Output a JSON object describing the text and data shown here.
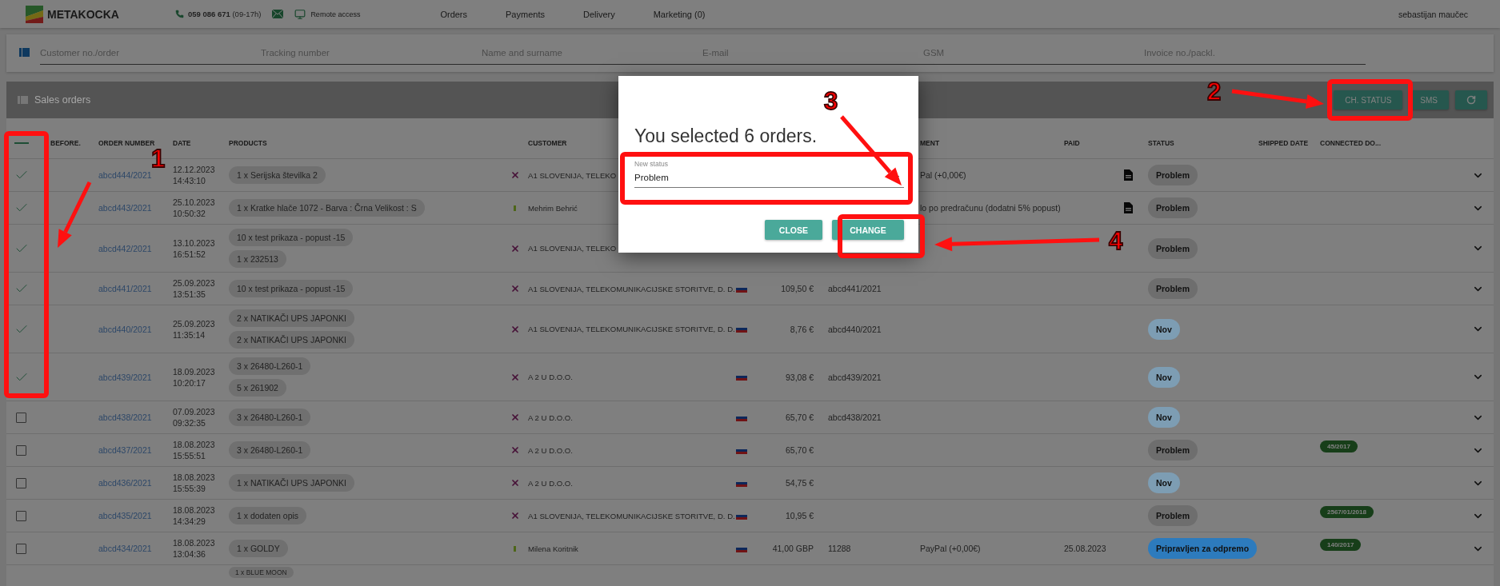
{
  "nav": {
    "brand": "METAKOCKA",
    "phone": "**059 086 671** (09-17h)",
    "remote": "Remote access",
    "menu": [
      {
        "label": "Orders"
      },
      {
        "label": "Payments"
      },
      {
        "label": "Delivery"
      },
      {
        "label": "Marketing (0)"
      }
    ],
    "user": "sebastijan maučec"
  },
  "search": {
    "fields": [
      {
        "placeholder": "Customer no./order"
      },
      {
        "placeholder": "Tracking number"
      },
      {
        "placeholder": "Name and surname"
      },
      {
        "placeholder": "E-mail"
      },
      {
        "placeholder": "GSM"
      },
      {
        "placeholder": "Invoice no./packl."
      }
    ]
  },
  "panel": {
    "title": "Sales orders",
    "buttons": [
      {
        "kind": "text",
        "label": "CH. STATUS"
      },
      {
        "kind": "text",
        "label": "SMS"
      },
      {
        "kind": "refresh"
      }
    ]
  },
  "table": {
    "header": {
      "before": "BEFORE.",
      "order": "ORDER NUMBER",
      "date": "DATE",
      "products": "PRODUCTS",
      "customer": "CUSTOMER",
      "payment": "MENT",
      "paid": "PAID",
      "status": "STATUS",
      "shipped": "SHIPPED DATE",
      "connected": "CONNECTED DO..."
    },
    "rows": [
      {
        "selected": true,
        "order": "abcd444/2021",
        "date": "12.12.2023",
        "time": "14:43:10",
        "products": [
          "1 x Serijska številka 2"
        ],
        "mark": {
          "kind": "cross"
        },
        "customer": "A1 SLOVENIJA, TELEKO",
        "flag": false,
        "payment": "Pal (+0,00€)",
        "invoice": true,
        "status": {
          "label": "Problem",
          "color": "#6e6e6e"
        }
      },
      {
        "selected": true,
        "order": "abcd443/2021",
        "date": "25.10.2023",
        "time": "10:50:32",
        "products": [
          "1 x Kratke hlače 1072 - Barva : Črna Velikost : S"
        ],
        "mark": {
          "kind": "dot"
        },
        "customer": "Mehrim Behrić",
        "flag": false,
        "payment": "lo po predračunu (dodatni 5% popust)",
        "invoice": true,
        "status": {
          "label": "Problem",
          "color": "#6e6e6e"
        }
      },
      {
        "selected": true,
        "order": "abcd442/2021",
        "date": "13.10.2023",
        "time": "16:51:52",
        "products": [
          "10 x test prikaza - popust -15",
          "1 x 232513"
        ],
        "mark": {
          "kind": "cross"
        },
        "customer": "A1 SLOVENIJA, TELEKO",
        "flag": false,
        "invoice": false,
        "status": {
          "label": "Problem",
          "color": "#6e6e6e"
        }
      },
      {
        "selected": true,
        "order": "abcd441/2021",
        "date": "25.09.2023",
        "time": "13:51:35",
        "products": [
          "10 x test prikaza - popust -15"
        ],
        "mark": {
          "kind": "cross"
        },
        "customer": "A1 SLOVENIJA, TELEKOMUNIKACIJSKE STORITVE, D. D.",
        "flag": true,
        "amount": "109,50 €",
        "number": "abcd441/2021",
        "invoice": false,
        "status": {
          "label": "Problem",
          "color": "#6e6e6e"
        }
      },
      {
        "selected": true,
        "order": "abcd440/2021",
        "date": "25.09.2023",
        "time": "11:35:14",
        "products": [
          "2 x NATIKAČI UPS JAPONKI",
          "2 x NATIKAČI UPS JAPONKI"
        ],
        "mark": {
          "kind": "cross"
        },
        "customer": "A1 SLOVENIJA, TELEKOMUNIKACIJSKE STORITVE, D. D.",
        "flag": true,
        "amount": "8,76 €",
        "number": "abcd440/2021",
        "invoice": false,
        "status": {
          "label": "Nov",
          "color": "#7d9db3"
        }
      },
      {
        "selected": true,
        "order": "abcd439/2021",
        "date": "18.09.2023",
        "time": "10:20:17",
        "products": [
          "3 x 26480-L260-1",
          "5 x 261902"
        ],
        "mark": {
          "kind": "cross"
        },
        "customer": "A 2 U D.O.O.",
        "flag": true,
        "amount": "93,08 €",
        "number": "abcd439/2021",
        "invoice": false,
        "status": {
          "label": "Nov",
          "color": "#7d9db3"
        }
      },
      {
        "selected": false,
        "order": "abcd438/2021",
        "date": "07.09.2023",
        "time": "09:32:35",
        "products": [
          "3 x 26480-L260-1"
        ],
        "mark": {
          "kind": "cross"
        },
        "customer": "A 2 U D.O.O.",
        "flag": true,
        "amount": "65,70 €",
        "number": "abcd438/2021",
        "invoice": false,
        "status": {
          "label": "Nov",
          "color": "#7d9db3"
        }
      },
      {
        "selected": false,
        "order": "abcd437/2021",
        "date": "18.08.2023",
        "time": "15:55:51",
        "products": [
          "3 x 26480-L260-1"
        ],
        "mark": {
          "kind": "cross"
        },
        "customer": "A 2 U D.O.O.",
        "flag": true,
        "amount": "65,70 €",
        "invoice": false,
        "status": {
          "label": "Problem",
          "color": "#6e6e6e"
        },
        "connected": "45/2017"
      },
      {
        "selected": false,
        "order": "abcd436/2021",
        "date": "18.08.2023",
        "time": "15:55:39",
        "products": [
          "1 x NATIKAČI UPS JAPONKI"
        ],
        "mark": {
          "kind": "cross"
        },
        "customer": "A 2 U D.O.O.",
        "flag": true,
        "amount": "54,75 €",
        "invoice": false,
        "status": {
          "label": "Nov",
          "color": "#7d9db3"
        }
      },
      {
        "selected": false,
        "order": "abcd435/2021",
        "date": "18.08.2023",
        "time": "14:34:29",
        "products": [
          "1 x dodaten opis"
        ],
        "mark": {
          "kind": "cross"
        },
        "customer": "A1 SLOVENIJA, TELEKOMUNIKACIJSKE STORITVE, D. D.",
        "flag": true,
        "amount": "10,95 €",
        "invoice": false,
        "status": {
          "label": "Problem",
          "color": "#6e6e6e"
        },
        "connected": "2567/01/2018"
      },
      {
        "selected": false,
        "order": "abcd434/2021",
        "date": "18.08.2023",
        "time": "13:04:36",
        "products": [
          "1 x GOLDY"
        ],
        "mark": {
          "kind": "dot"
        },
        "customer": "Milena Koritnik",
        "flag": true,
        "amount": "41,00 GBP",
        "number": "11288",
        "payment": "PayPal (+0,00€)",
        "invoice": false,
        "paid": "25.08.2023",
        "status": {
          "label": "Pripravljen za odpremo",
          "color": "#2d7bbd"
        },
        "connected": "140/2017"
      }
    ],
    "partial_row": {
      "products": [
        "1 x BLUE MOON"
      ]
    }
  },
  "modal": {
    "title": "You selected 6 orders.",
    "field_label": "New status",
    "field_value": "Problem",
    "buttons": [
      {
        "label": "CLOSE"
      },
      {
        "label": "CHANGE"
      }
    ]
  },
  "annotations": [
    {
      "label": "1"
    },
    {
      "label": "2"
    },
    {
      "label": "3"
    },
    {
      "label": "4"
    }
  ]
}
